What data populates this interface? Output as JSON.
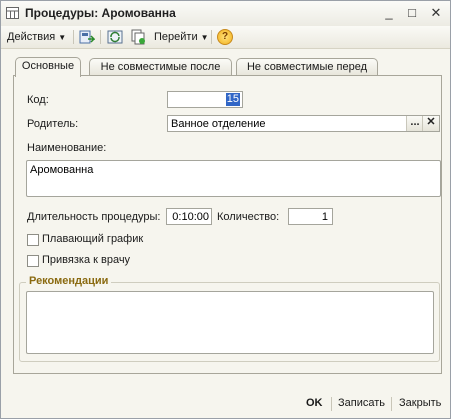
{
  "window": {
    "title": "Процедуры: Аромованна",
    "controls": {
      "minimize": "_",
      "maximize": "□",
      "close": "✕"
    }
  },
  "toolbar": {
    "actions_label": "Действия",
    "goto_label": "Перейти",
    "help_label": "?"
  },
  "tabs": [
    {
      "label": "Основные",
      "active": true
    },
    {
      "label": "Не совместимые после",
      "active": false
    },
    {
      "label": "Не совместимые перед",
      "active": false
    }
  ],
  "form": {
    "code_label": "Код:",
    "code_value": "15",
    "parent_label": "Родитель:",
    "parent_value": "Ванное отделение",
    "parent_select_btn": "...",
    "parent_clear_btn": "✕",
    "name_label": "Наименование:",
    "name_value": "Аромованна",
    "duration_label": "Длительность процедуры:",
    "duration_value": "0:10:00",
    "quantity_label": "Количество:",
    "quantity_value": "1",
    "floating_schedule_label": "Плавающий график",
    "floating_schedule_checked": false,
    "doctor_binding_label": "Привязка к врачу",
    "doctor_binding_checked": false,
    "recommendations_label": "Рекомендации",
    "recommendations_value": ""
  },
  "footer": {
    "ok_label": "OK",
    "save_label": "Записать",
    "close_label": "Закрыть"
  },
  "colors": {
    "selection": "#3166c6",
    "group_title": "#8a6a10",
    "help_icon": "#f2b01e"
  }
}
